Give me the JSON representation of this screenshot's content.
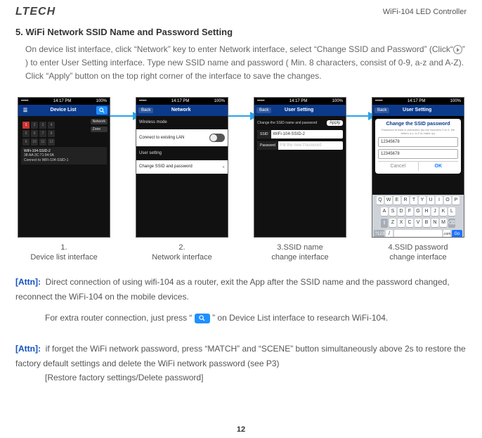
{
  "header": {
    "brand": "LTECH",
    "doc_title": "WiFi-104 LED Controller"
  },
  "section": {
    "title": "5. WiFi Network SSID Name and Password Setting",
    "body": "On device list interface, click “Network” key to enter Network interface, select “Change SSID and Password” (Click“     ” ) to enter User Setting interface. Type new SSID name and password ( Min. 8 characters, consist of 0-9, a-z and A-Z). Click “Apply” button on the top right corner of the interface to save the changes."
  },
  "status": {
    "time1": "14:17 PM",
    "time2": "14:17 PM",
    "time3": "14:17 PM",
    "time4": "14:17 PM",
    "batt": "100%",
    "sig": "•••••"
  },
  "screen1": {
    "title": "Device List",
    "side": {
      "network": "Network",
      "zone": "Zone"
    },
    "dev_name": "WiFi-104-SSID-2",
    "dev_mac": "38:AA:3C:71:94:0A",
    "dev_conn": "Connect to WiFi-104-SSID-1",
    "caption_no": "1.",
    "caption": "Device list interface"
  },
  "screen2": {
    "back": "Back",
    "title": "Network",
    "rows": {
      "mode": "Wireless mode",
      "connect": "Connect to existing LAN",
      "usersetting": "User setting",
      "change": "Change SSID and password"
    },
    "caption_no": "2.",
    "caption": "Network interface"
  },
  "screen3": {
    "back": "Back",
    "title": "User Setting",
    "headline": "Change the SSID name and password",
    "apply": "Apply",
    "ssid_label": "SSID",
    "ssid_val": "WiFi-104-SSID-2",
    "pwd_label": "Password",
    "pwd_ph": "Fill the new Password",
    "caption_no": "3.SSID name",
    "caption": "change  interface"
  },
  "screen4": {
    "back": "Back",
    "title": "User Setting",
    "box_title": "Change the SSID password",
    "box_sub": "Password at least 8 characters\n(by the Numbers 0 to 9, the letters a-z, A-Z to make up)",
    "field1": "12345678",
    "field2": "12345678",
    "cancel": "Cancel",
    "ok": "OK",
    "kb_r1": [
      "Q",
      "W",
      "E",
      "R",
      "T",
      "Y",
      "U",
      "I",
      "O",
      "P"
    ],
    "kb_r2": [
      "A",
      "S",
      "D",
      "F",
      "G",
      "H",
      "J",
      "K",
      "L"
    ],
    "kb_r3": [
      "Z",
      "X",
      "C",
      "V",
      "B",
      "N",
      "M"
    ],
    "kb_shift": "⇧",
    "kb_del": "⌫",
    "kb_123": ".?123",
    "kb_slash": "/",
    "kb_com": ".com",
    "kb_go": "Go",
    "caption_no": "4.SSID password",
    "caption": "change  interface"
  },
  "attn1": {
    "label": "[Attn]:",
    "line1": "Direct connection of using wifi-104 as a router, exit the App after the SSID name and the password changed, reconnect the WiFi-104 on the mobile devices.",
    "line2a": "For extra router connection, just press  “ ",
    "line2b": " ”  on Device List interface to research WiFi-104."
  },
  "attn2": {
    "label": "[Attn]:",
    "line1": "if forget the WiFi network password, press “MATCH” and “SCENE” button simultaneously above 2s to restore the factory default settings and delete the WiFi network password (see P3)",
    "line2": "[Restore factory settings/Delete password]"
  },
  "pagenum": "12"
}
